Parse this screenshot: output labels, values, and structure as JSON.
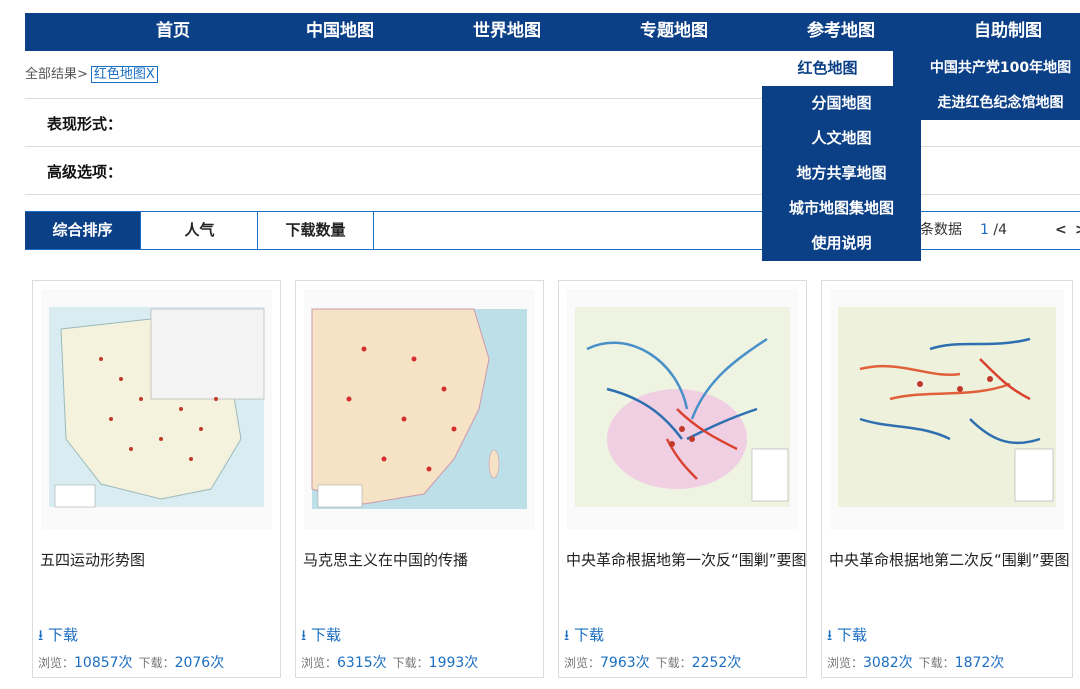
{
  "nav": {
    "items": [
      "首页",
      "中国地图",
      "世界地图",
      "专题地图",
      "参考地图",
      "自助制图"
    ]
  },
  "breadcrumb": {
    "root": "全部结果>",
    "tag": "红色地图X"
  },
  "filters": {
    "form_label": "表现形式：",
    "advanced_label": "高级选项："
  },
  "sort": {
    "items": [
      "综合排序",
      "人气",
      "下载数量"
    ],
    "count_suffix": "条数据",
    "page_current": "1",
    "page_total": "/4",
    "prev": "<",
    "next": ">"
  },
  "dropdown": {
    "items": [
      "红色地图",
      "分国地图",
      "人文地图",
      "地方共享地图",
      "城市地图集地图",
      "使用说明"
    ],
    "sub_items": [
      "中国共产党100年地图",
      "走进红色纪念馆地图"
    ]
  },
  "cards": [
    {
      "title": "五四运动形势图",
      "download": "下载",
      "views_label": "浏览：",
      "views": "10857次",
      "downloads_label": "下载：",
      "downloads": "2076次"
    },
    {
      "title": "马克思主义在中国的传播",
      "download": "下载",
      "views_label": "浏览：",
      "views": "6315次",
      "downloads_label": "下载：",
      "downloads": "1993次"
    },
    {
      "title": "中央革命根据地第一次反“围剿”要图",
      "download": "下载",
      "views_label": "浏览：",
      "views": "7963次",
      "downloads_label": "下载：",
      "downloads": "2252次"
    },
    {
      "title": "中央革命根据地第二次反“围剿”要图",
      "download": "下载",
      "views_label": "浏览：",
      "views": "3082次",
      "downloads_label": "下载：",
      "downloads": "1872次"
    }
  ],
  "colors": {
    "brand": "#0b3f86",
    "link": "#1b6ec2"
  }
}
